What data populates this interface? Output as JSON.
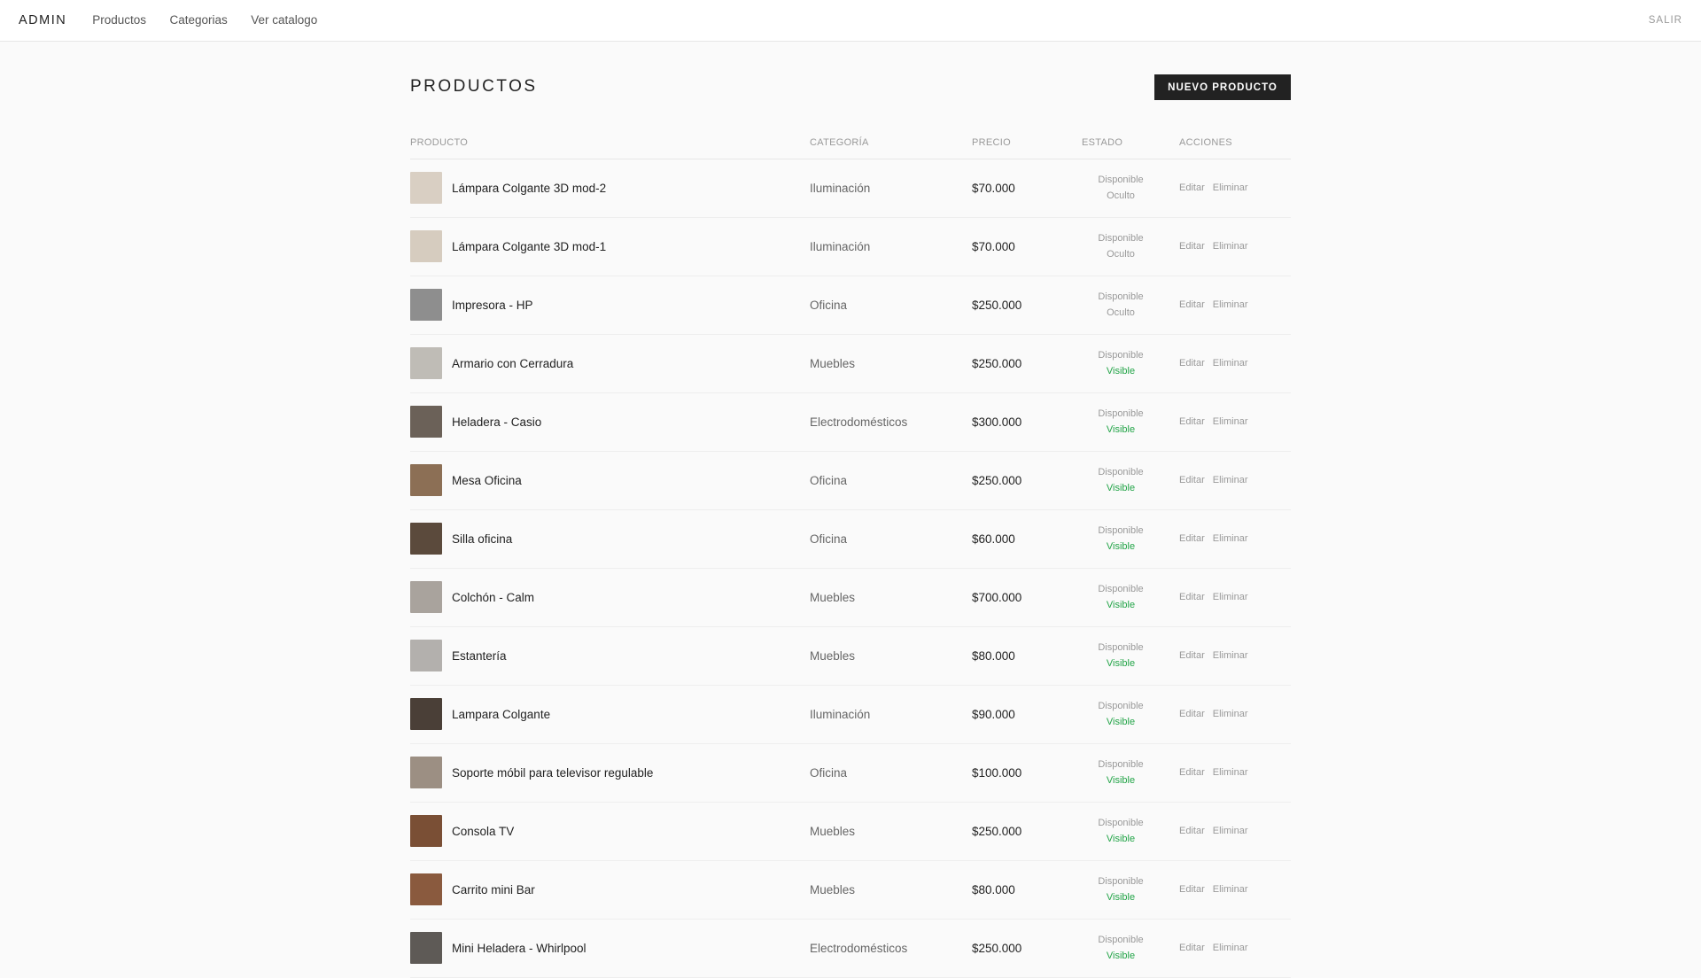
{
  "nav": {
    "brand": "ADMIN",
    "links": [
      "Productos",
      "Categorias",
      "Ver catalogo"
    ],
    "logout": "SALIR"
  },
  "page": {
    "title": "PRODUCTOS",
    "new_button": "NUEVO PRODUCTO"
  },
  "table": {
    "headers": [
      "PRODUCTO",
      "CATEGORÍA",
      "PRECIO",
      "ESTADO",
      "ACCIONES"
    ],
    "action_edit": "Editar",
    "action_delete": "Eliminar",
    "rows": [
      {
        "name": "Lámpara Colgante 3D mod-2",
        "category": "Iluminación",
        "price": "$70.000",
        "availability": "Disponible",
        "visibility": "Oculto",
        "thumb": "#d9cfc3"
      },
      {
        "name": "Lámpara Colgante 3D mod-1",
        "category": "Iluminación",
        "price": "$70.000",
        "availability": "Disponible",
        "visibility": "Oculto",
        "thumb": "#d6ccbf"
      },
      {
        "name": "Impresora - HP",
        "category": "Oficina",
        "price": "$250.000",
        "availability": "Disponible",
        "visibility": "Oculto",
        "thumb": "#8e8e8e"
      },
      {
        "name": "Armario con Cerradura",
        "category": "Muebles",
        "price": "$250.000",
        "availability": "Disponible",
        "visibility": "Visible",
        "thumb": "#bfbcb6"
      },
      {
        "name": "Heladera - Casio",
        "category": "Electrodomésticos",
        "price": "$300.000",
        "availability": "Disponible",
        "visibility": "Visible",
        "thumb": "#6b6158"
      },
      {
        "name": "Mesa Oficina",
        "category": "Oficina",
        "price": "$250.000",
        "availability": "Disponible",
        "visibility": "Visible",
        "thumb": "#8c6f55"
      },
      {
        "name": "Silla oficina",
        "category": "Oficina",
        "price": "$60.000",
        "availability": "Disponible",
        "visibility": "Visible",
        "thumb": "#5b4a3c"
      },
      {
        "name": "Colchón - Calm",
        "category": "Muebles",
        "price": "$700.000",
        "availability": "Disponible",
        "visibility": "Visible",
        "thumb": "#a9a39d"
      },
      {
        "name": "Estantería",
        "category": "Muebles",
        "price": "$80.000",
        "availability": "Disponible",
        "visibility": "Visible",
        "thumb": "#b3b0ad"
      },
      {
        "name": "Lampara Colgante",
        "category": "Iluminación",
        "price": "$90.000",
        "availability": "Disponible",
        "visibility": "Visible",
        "thumb": "#4a3f37"
      },
      {
        "name": "Soporte móbil para televisor regulable",
        "category": "Oficina",
        "price": "$100.000",
        "availability": "Disponible",
        "visibility": "Visible",
        "thumb": "#9c8f83"
      },
      {
        "name": "Consola TV",
        "category": "Muebles",
        "price": "$250.000",
        "availability": "Disponible",
        "visibility": "Visible",
        "thumb": "#7a4f35"
      },
      {
        "name": "Carrito mini Bar",
        "category": "Muebles",
        "price": "$80.000",
        "availability": "Disponible",
        "visibility": "Visible",
        "thumb": "#8a5a3e"
      },
      {
        "name": "Mini Heladera - Whirlpool",
        "category": "Electrodomésticos",
        "price": "$250.000",
        "availability": "Disponible",
        "visibility": "Visible",
        "thumb": "#5e5a56"
      }
    ]
  },
  "colors": {
    "visible": "#22a447",
    "muted": "#999999",
    "button_bg": "#222222"
  }
}
